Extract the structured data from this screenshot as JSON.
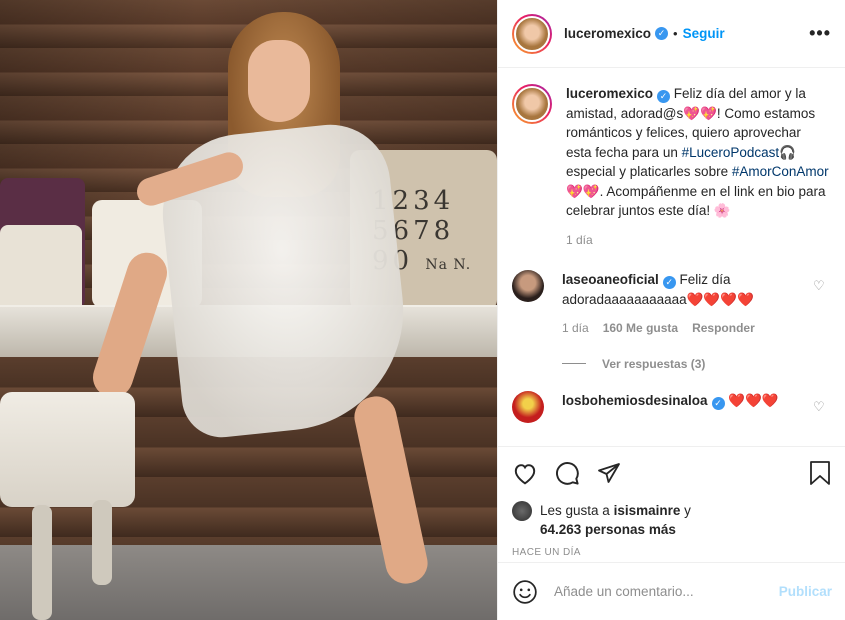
{
  "post": {
    "username": "luceromexico",
    "follow_label": "Seguir",
    "separator": "•",
    "more_label": "•••"
  },
  "photo": {
    "pillow_numbers_line1": "1234",
    "pillow_numbers_line2": "5678",
    "pillow_numbers_line3": "90",
    "pillow_numbers_suffix": "Na N."
  },
  "caption": {
    "username": "luceromexico",
    "text_part1": " Feliz día del amor y la amistad, adorad@s💖💖! Como estamos románticos y felices, quiero aprovechar esta fecha para un ",
    "hashtag1": "#LuceroPodcast",
    "text_part2": "🎧 especial y platicarles sobre ",
    "hashtag2": "#AmorConAmor",
    "text_part3": "💖💖. Acompáñenme en el link en bio para celebrar juntos este día! 🌸",
    "time": "1 día"
  },
  "comments": [
    {
      "username": "laseoaneoficial",
      "text": " Feliz día adoradaaaaaaaaaaa❤️❤️❤️❤️",
      "time": "1 día",
      "likes": "160 Me gusta",
      "reply": "Responder",
      "view_replies": "Ver respuestas (3)"
    },
    {
      "username": "losbohemiosdesinaloa",
      "text": " ❤️❤️❤️"
    }
  ],
  "likes": {
    "prefix": "Les gusta a ",
    "user": "isismainre",
    "mid": " y",
    "count": "64.263 personas más"
  },
  "timestamp": "HACE UN DÍA",
  "add_comment": {
    "placeholder": "Añade un comentario...",
    "post_label": "Publicar"
  },
  "colors": {
    "accent": "#0095f6",
    "verified": "#3897f0",
    "link": "#00376b",
    "muted": "#8e8e8e",
    "post_disabled": "#b2dffc"
  },
  "icons": [
    "heart-icon",
    "comment-icon",
    "share-icon",
    "bookmark-icon",
    "emoji-icon",
    "more-icon",
    "verified-icon"
  ]
}
